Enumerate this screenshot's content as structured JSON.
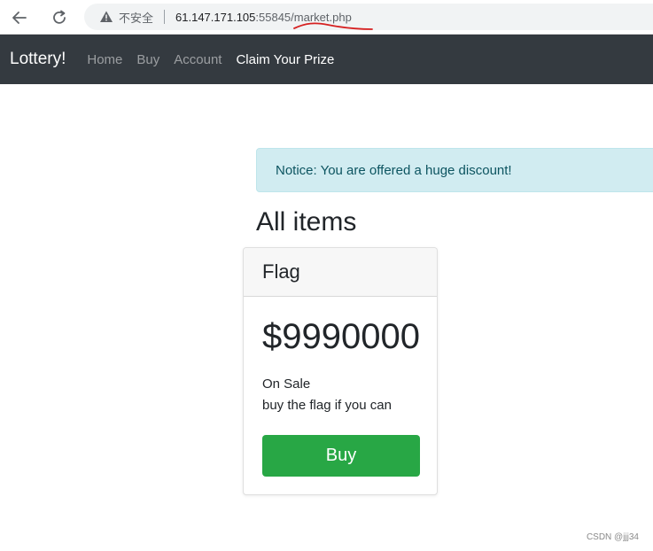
{
  "browser": {
    "security_text": "不安全",
    "url_host": "61.147.171.105",
    "url_rest": ":55845/market.php",
    "scribble_color": "#d62020"
  },
  "navbar": {
    "brand": "Lottery!",
    "links": [
      {
        "label": "Home"
      },
      {
        "label": "Buy"
      },
      {
        "label": "Account"
      },
      {
        "label": "Claim Your Prize"
      }
    ],
    "active_index": 3
  },
  "notice": {
    "text": "Notice: You are offered a huge discount!"
  },
  "main": {
    "title": "All items",
    "card": {
      "header": "Flag",
      "price": "$9990000",
      "status": "On Sale",
      "description": "buy the flag if you can",
      "buy_label": "Buy"
    }
  },
  "watermark": "CSDN @jjj34",
  "colors": {
    "navbar_bg": "#343a40",
    "notice_bg": "#d1ecf1",
    "buy_button": "#28a745"
  }
}
